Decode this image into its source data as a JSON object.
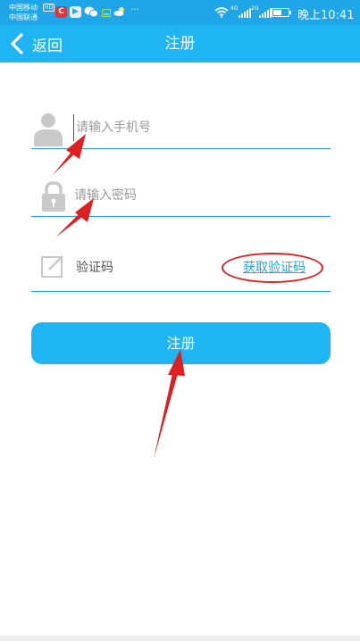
{
  "status_bar": {
    "carrier_1": "中国移动",
    "carrier_1_badge": "HD",
    "carrier_2": "中国联通",
    "more_indicator": "···",
    "network_4g": "4G",
    "network_2g": "2G",
    "battery_level": 0.55,
    "time": "晚上10:41",
    "icons": [
      "c-app-icon",
      "video-app-icon",
      "wechat-icon",
      "storage-icon",
      "weather-icon",
      "wifi-icon",
      "signal-icon",
      "battery-icon"
    ],
    "background_color": "#1fa6e8"
  },
  "title_bar": {
    "back_label": "返回",
    "title": "注册",
    "background_color": "#1fb4f4"
  },
  "form": {
    "phone": {
      "placeholder": "请输入手机号",
      "icon": "user-icon"
    },
    "password": {
      "placeholder": "请输入密码",
      "icon": "lock-icon"
    },
    "code": {
      "label": "验证码",
      "icon": "edit-icon",
      "get_code_link": "获取验证码"
    },
    "submit_label": "注册",
    "accent_color": "#1fa6e8"
  },
  "annotations": {
    "color": "#e02020",
    "arrows": [
      "phone-field-arrow",
      "password-field-arrow",
      "register-button-arrow"
    ],
    "highlight": "get-code-link-circle"
  }
}
